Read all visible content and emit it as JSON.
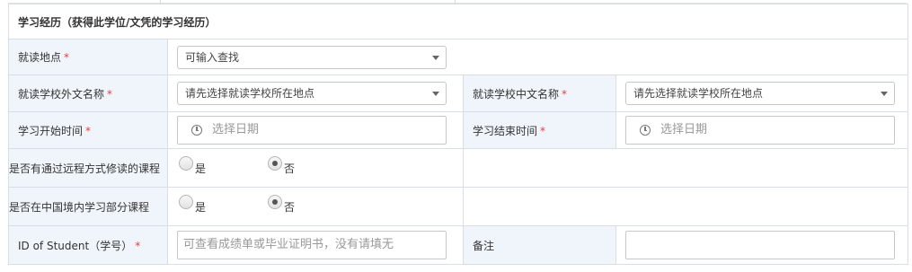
{
  "section": {
    "title": "学习经历（获得此学位/文凭的学习经历）"
  },
  "fields": {
    "location": {
      "label": "就读地点",
      "required": "*",
      "value": "可输入查找"
    },
    "school_foreign": {
      "label": "就读学校外文名称",
      "required": "*",
      "value": "请先选择就读学校所在地点"
    },
    "school_chinese": {
      "label": "就读学校中文名称",
      "required": "*",
      "value": "请先选择就读学校所在地点"
    },
    "start_date": {
      "label": "学习开始时间",
      "required": "*",
      "placeholder": "选择日期"
    },
    "end_date": {
      "label": "学习结束时间",
      "required": "*",
      "placeholder": "选择日期"
    },
    "distance": {
      "label": "是否有通过远程方式修读的课程",
      "yes": "是",
      "no": "否",
      "selected": "否"
    },
    "in_china": {
      "label": "是否在中国境内学习部分课程",
      "yes": "是",
      "no": "否",
      "selected": "否"
    },
    "student_id": {
      "label": "ID of Student（学号）",
      "required": "*",
      "placeholder": "可查看成绩单或毕业证明书，没有请填无"
    },
    "remark": {
      "label": "备注",
      "value": ""
    }
  },
  "colors": {
    "label_bg": "#f0f5fb",
    "required": "#e63e3e",
    "border": "#d9dee6"
  }
}
